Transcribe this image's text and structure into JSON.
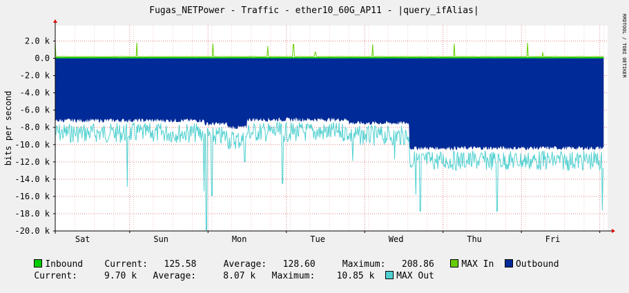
{
  "chart_data": {
    "type": "area",
    "title": "Fugas_NETPower - Traffic - ether10_60G_AP11 - |query_ifAlias|",
    "ylabel": "bits per second",
    "watermark": "RRDTOOL / TOBI OETIKER",
    "ylim": [
      -20000,
      3800
    ],
    "y_ticks": [
      {
        "value": 2000,
        "label": "2.0 k"
      },
      {
        "value": 0,
        "label": "0.0"
      },
      {
        "value": -2000,
        "label": "-2.0 k"
      },
      {
        "value": -4000,
        "label": "-4.0 k"
      },
      {
        "value": -6000,
        "label": "-6.0 k"
      },
      {
        "value": -8000,
        "label": "-8.0 k"
      },
      {
        "value": -10000,
        "label": "-10.0 k"
      },
      {
        "value": -12000,
        "label": "-12.0 k"
      },
      {
        "value": -14000,
        "label": "-14.0 k"
      },
      {
        "value": -16000,
        "label": "-16.0 k"
      },
      {
        "value": -18000,
        "label": "-18.0 k"
      },
      {
        "value": -20000,
        "label": "-20.0 k"
      }
    ],
    "x_range": [
      0,
      7.05
    ],
    "x_ticks": [
      {
        "value": 0.35,
        "label": "Sat"
      },
      {
        "value": 1.35,
        "label": "Sun"
      },
      {
        "value": 2.35,
        "label": "Mon"
      },
      {
        "value": 3.35,
        "label": "Tue"
      },
      {
        "value": 4.35,
        "label": "Wed"
      },
      {
        "value": 5.35,
        "label": "Thu"
      },
      {
        "value": 6.35,
        "label": "Fri"
      }
    ],
    "grid": true,
    "series": [
      {
        "name": "Inbound",
        "color": "#00cc00",
        "kind": "area",
        "baseline": 130,
        "spikes": [
          [
            0.0,
            1900
          ],
          [
            1.04,
            1800
          ],
          [
            2.01,
            1700
          ],
          [
            2.71,
            1400
          ],
          [
            3.04,
            1600
          ],
          [
            3.32,
            700
          ],
          [
            4.05,
            1600
          ],
          [
            5.09,
            1700
          ],
          [
            6.03,
            1800
          ],
          [
            6.22,
            700
          ]
        ]
      },
      {
        "name": "MAX In",
        "color": "#66cc00",
        "kind": "line"
      },
      {
        "name": "Outbound",
        "color": "#002a97",
        "kind": "area",
        "segments": [
          [
            0.0,
            1.9,
            -7200
          ],
          [
            1.9,
            2.2,
            -7600
          ],
          [
            2.2,
            2.45,
            -8000
          ],
          [
            2.45,
            3.75,
            -7100
          ],
          [
            3.75,
            4.52,
            -7500
          ],
          [
            4.52,
            7.0,
            -10400
          ]
        ]
      },
      {
        "name": "MAX Out",
        "color": "#50d0d0",
        "kind": "line",
        "dips": [
          [
            0.92,
            -14900
          ],
          [
            1.9,
            -15400
          ],
          [
            1.93,
            -19900
          ],
          [
            2.0,
            -15900
          ],
          [
            2.42,
            -12000
          ],
          [
            2.9,
            -14500
          ],
          [
            3.8,
            -11900
          ],
          [
            4.33,
            -11700
          ],
          [
            4.6,
            -15800
          ],
          [
            4.66,
            -17700
          ],
          [
            5.64,
            -17700
          ],
          [
            6.98,
            -17600
          ]
        ]
      }
    ]
  },
  "legend": {
    "row1": [
      {
        "color": "#00cc00",
        "text": "Inbound    Current:   125.58     Average:   128.60     Maximum:   208.86"
      },
      {
        "color": "#66cc00",
        "text": "MAX In"
      },
      {
        "color": "#002a97",
        "text": "Outbound"
      }
    ],
    "row2": [
      {
        "text": "Current:     9.70 k   Average:     8.07 k   Maximum:    10.85 k"
      },
      {
        "color": "#50d0d0",
        "text": "MAX Out"
      }
    ]
  }
}
